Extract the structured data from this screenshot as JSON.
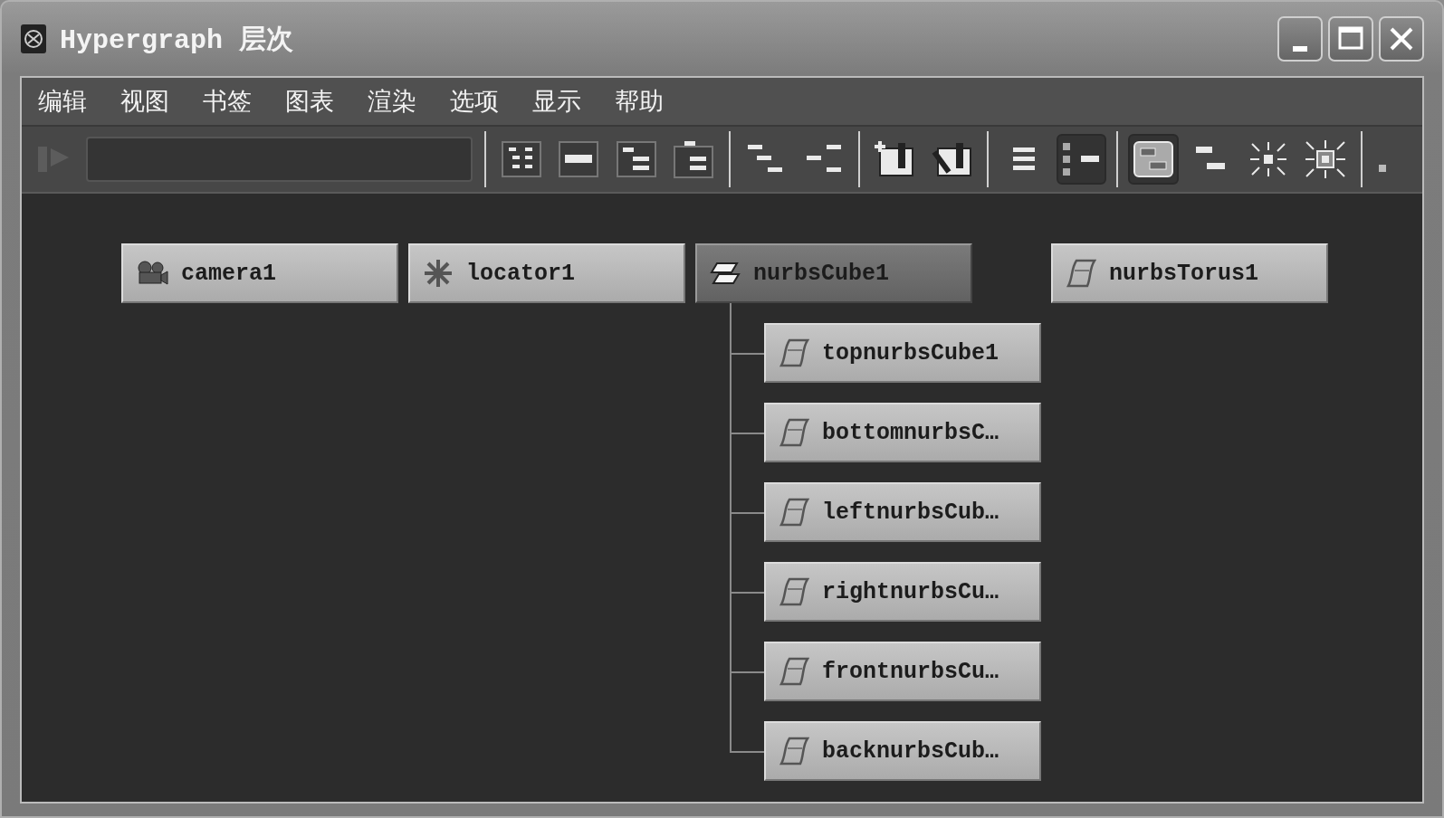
{
  "window": {
    "title": "Hypergraph 层次"
  },
  "menu": [
    "编辑",
    "视图",
    "书签",
    "图表",
    "渲染",
    "选项",
    "显示",
    "帮助"
  ],
  "toolbar": [
    {
      "kind": "selection-arrows",
      "selected": false
    },
    {
      "kind": "field"
    },
    {
      "kind": "separator"
    },
    {
      "kind": "frame-all",
      "selected": false
    },
    {
      "kind": "frame-selection",
      "selected": false
    },
    {
      "kind": "frame-hierarchy",
      "selected": false
    },
    {
      "kind": "frame-branch",
      "selected": false
    },
    {
      "kind": "separator"
    },
    {
      "kind": "tree-layout",
      "selected": false
    },
    {
      "kind": "tree-reverse",
      "selected": false
    },
    {
      "kind": "separator"
    },
    {
      "kind": "bookmark-add",
      "selected": false
    },
    {
      "kind": "bookmark-edit",
      "selected": false
    },
    {
      "kind": "separator"
    },
    {
      "kind": "list",
      "selected": false
    },
    {
      "kind": "hierarchy",
      "selected": true
    },
    {
      "kind": "separator"
    },
    {
      "kind": "scene",
      "selected": true
    },
    {
      "kind": "connections",
      "selected": false
    },
    {
      "kind": "expand-in",
      "selected": false
    },
    {
      "kind": "expand-out",
      "selected": false
    },
    {
      "kind": "separator"
    },
    {
      "kind": "more",
      "selected": false
    }
  ],
  "nodes": [
    {
      "label": "camera1",
      "kind": "camera",
      "selected": false
    },
    {
      "label": "locator1",
      "kind": "locator",
      "selected": false
    },
    {
      "label": "nurbsCube1",
      "kind": "transform",
      "selected": true,
      "children": [
        {
          "label": "topnurbsCube1",
          "kind": "surface",
          "selected": false
        },
        {
          "label": "bottomnurbsC…",
          "kind": "surface",
          "selected": false
        },
        {
          "label": "leftnurbsCub…",
          "kind": "surface",
          "selected": false
        },
        {
          "label": "rightnurbsCu…",
          "kind": "surface",
          "selected": false
        },
        {
          "label": "frontnurbsCu…",
          "kind": "surface",
          "selected": false
        },
        {
          "label": "backnurbsCub…",
          "kind": "surface",
          "selected": false
        }
      ]
    },
    {
      "label": "nurbsTorus1",
      "kind": "surface",
      "selected": false
    }
  ]
}
